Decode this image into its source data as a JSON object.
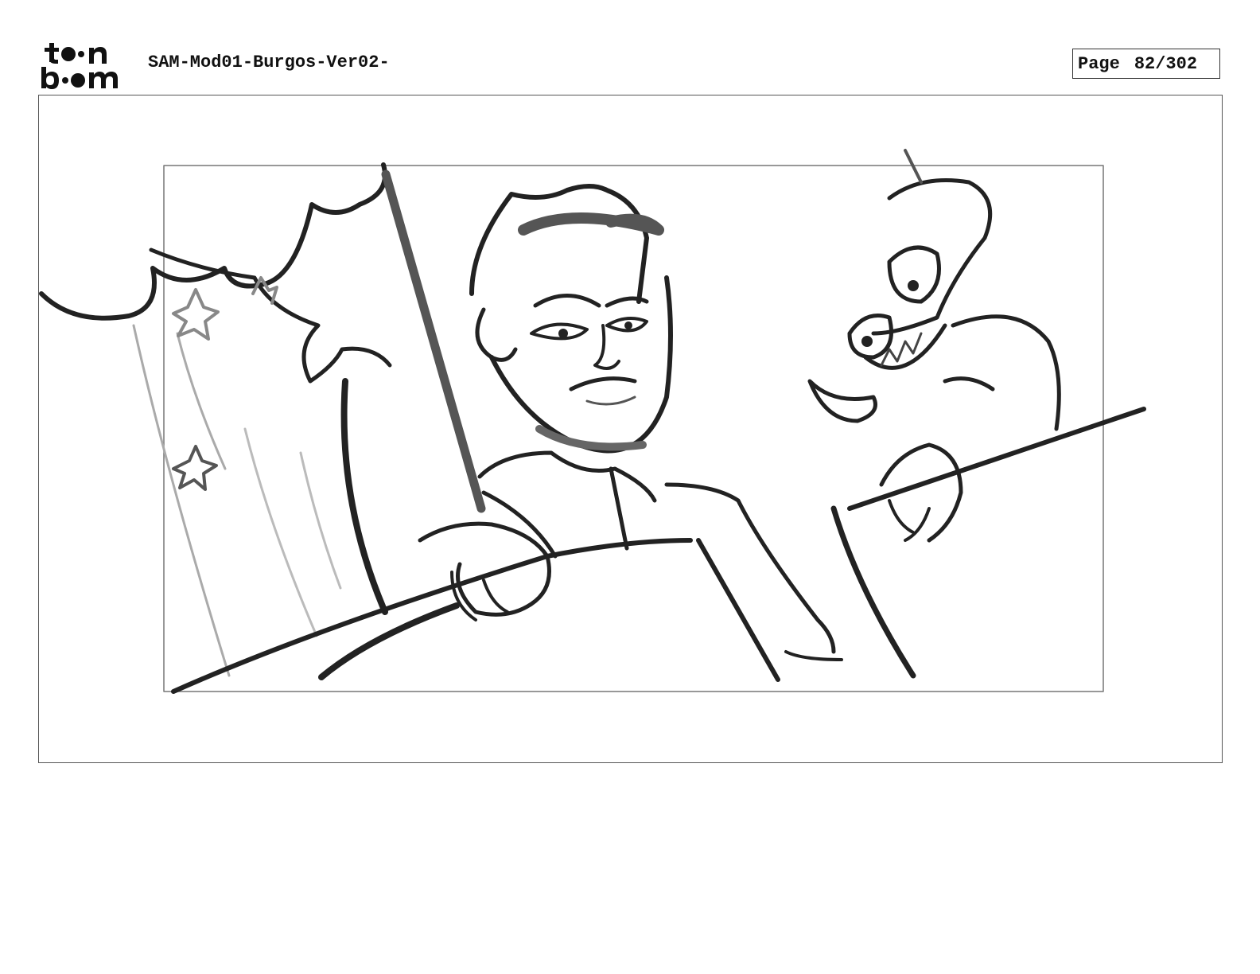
{
  "header": {
    "logo_text_top": "toon",
    "logo_text_bottom": "boom",
    "document_title": "SAM-Mod01-Burgos-Ver02-",
    "page_label": "Page",
    "page_number": "82/302"
  },
  "panel": {
    "icons": [
      "storyboard-sketch"
    ]
  }
}
